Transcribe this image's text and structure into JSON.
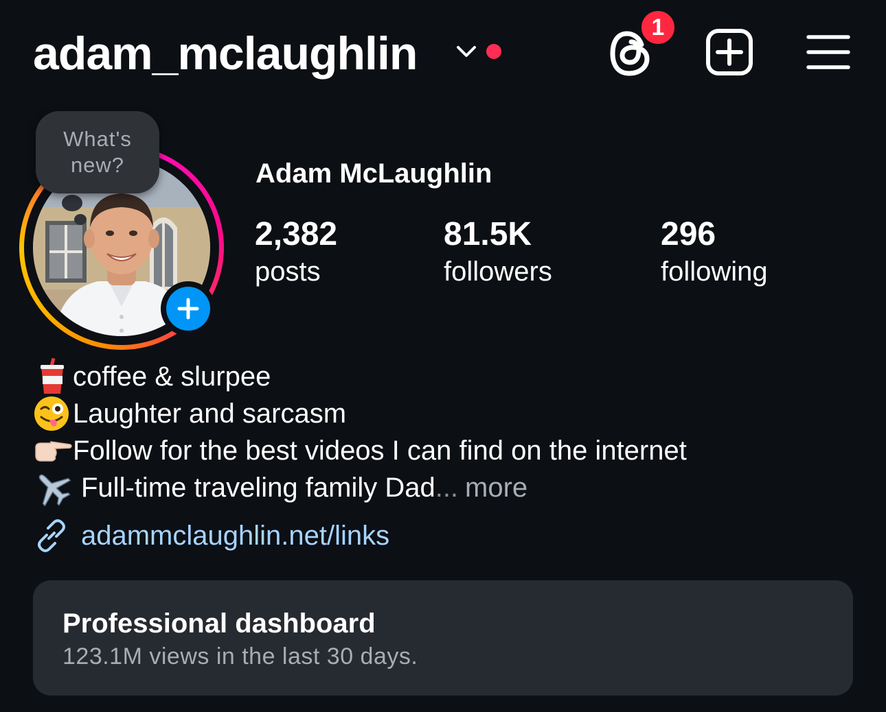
{
  "header": {
    "username": "adam_mclaughlin",
    "threads_badge_count": "1",
    "icons": [
      "chevron-down-icon",
      "threads-icon",
      "create-plus-icon",
      "hamburger-menu-icon"
    ],
    "accent_red": "#ff2d55"
  },
  "note": {
    "text": "What's new?"
  },
  "profile": {
    "display_name": "Adam McLaughlin",
    "stats": {
      "posts": {
        "value": "2,382",
        "label": "posts"
      },
      "followers": {
        "value": "81.5K",
        "label": "followers"
      },
      "following": {
        "value": "296",
        "label": "following"
      }
    }
  },
  "bio": {
    "lines": [
      {
        "icon": "drink-cup-icon",
        "text": "coffee & slurpee"
      },
      {
        "icon": "winking-tongue-face-icon",
        "text": "Laughter and sarcasm"
      },
      {
        "icon": "pointing-right-hand-icon",
        "text": "Follow for the best videos I can find on the internet"
      },
      {
        "icon": "airplane-icon",
        "text": "Full-time traveling family Dad"
      }
    ],
    "ellipsis": "...",
    "more_label": "more",
    "link": "adammclaughlin.net/links"
  },
  "dashboard": {
    "title": "Professional dashboard",
    "subtitle": "123.1M views in the last 30 days."
  },
  "colors": {
    "background": "#0c0f14",
    "card": "#262a31",
    "link": "#a6d4ff",
    "add_story_blue": "#0095f6"
  }
}
